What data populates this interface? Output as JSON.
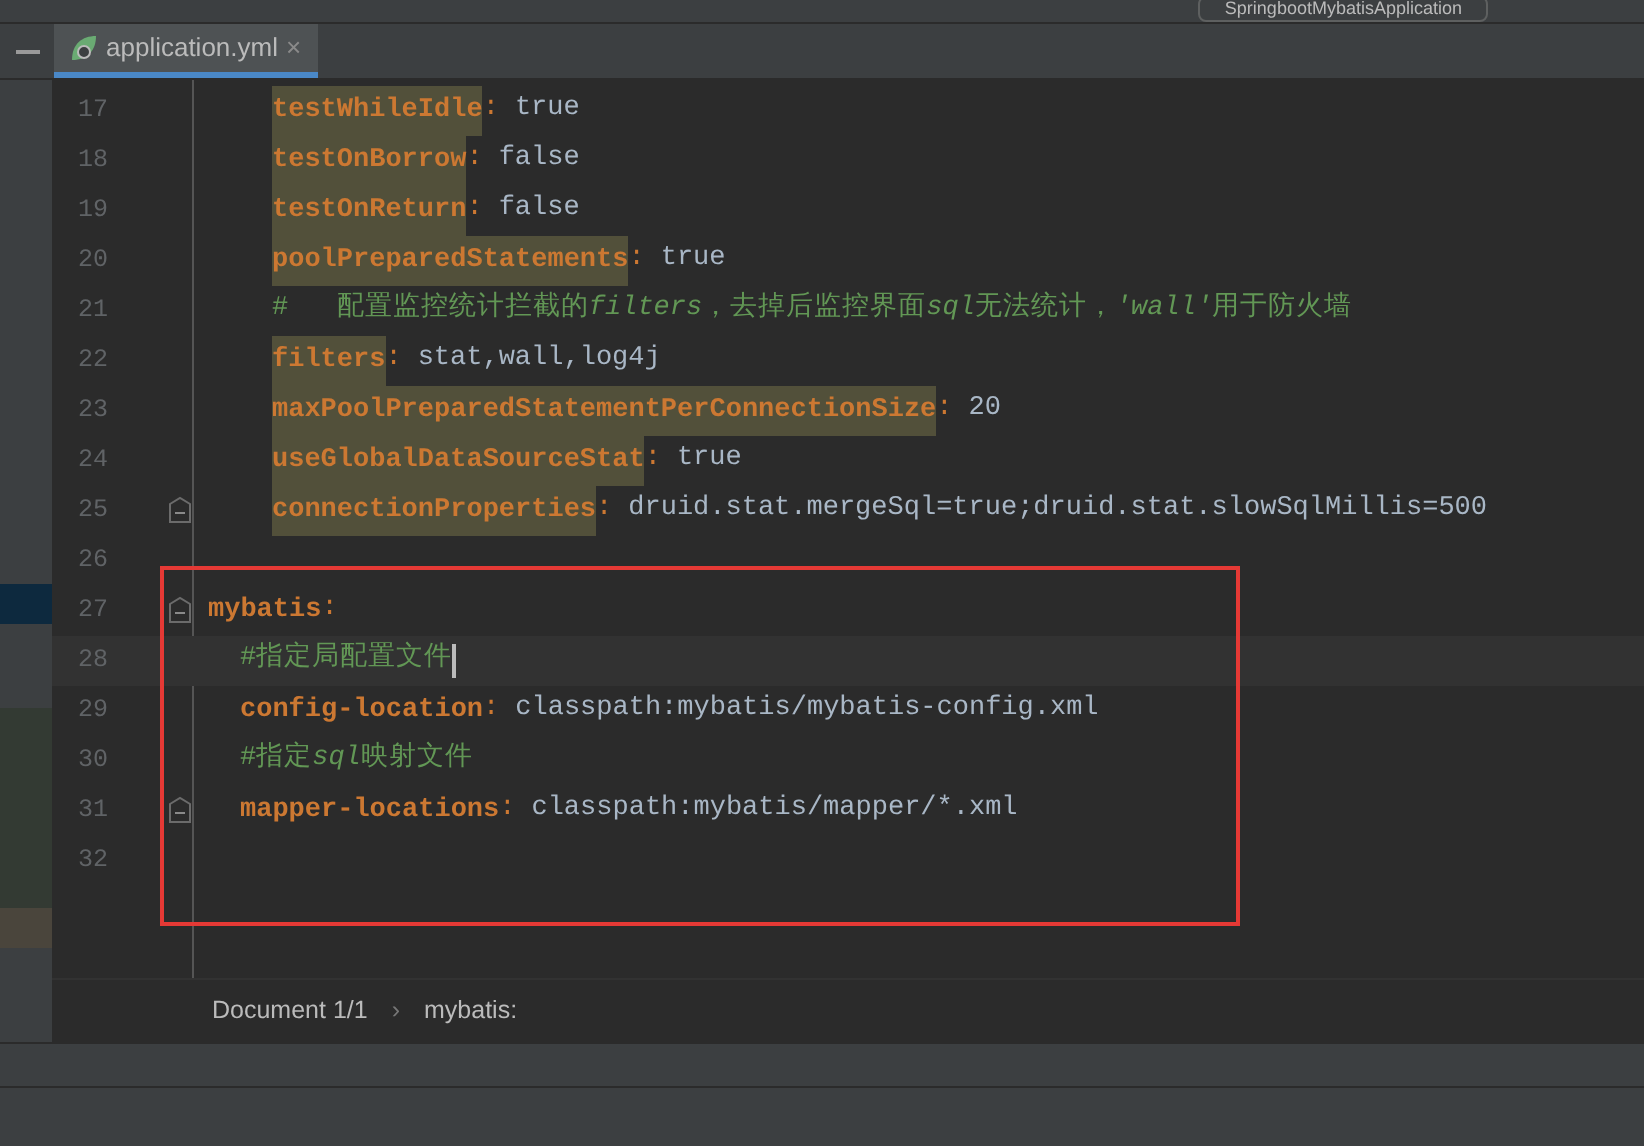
{
  "toolbar": {
    "run_config": "SpringbootMybatisApplication"
  },
  "tabs": [
    {
      "label": "application.yml",
      "close": "×",
      "selected": true
    }
  ],
  "editor": {
    "lines": [
      {
        "kind": "offscreen_parent",
        "children": [
          {
            "kind": "offscreen_parent",
            "children": [
              {
                "kind": "pair",
                "number": "17",
                "key": "testWhileIdle",
                "separator": ":",
                "highlighted": true,
                "value": "true"
              },
              {
                "kind": "pair",
                "number": "18",
                "key": "testOnBorrow",
                "separator": ":",
                "highlighted": true,
                "value": "false"
              },
              {
                "kind": "pair",
                "number": "19",
                "key": "testOnReturn",
                "separator": ":",
                "highlighted": true,
                "value": "false"
              },
              {
                "kind": "pair",
                "number": "20",
                "key": "poolPreparedStatements",
                "separator": ":",
                "highlighted": true,
                "value": "true"
              },
              {
                "kind": "comment",
                "number": "21",
                "comment": [
                  {
                    "text": "#   配置监控统计拦截的",
                    "italic": false
                  },
                  {
                    "text": "filters",
                    "italic": true
                  },
                  {
                    "text": "，去掉后监控界面",
                    "italic": false
                  },
                  {
                    "text": "sql",
                    "italic": true
                  },
                  {
                    "text": "无法统计，",
                    "italic": false
                  },
                  {
                    "text": "'wall'",
                    "italic": true
                  },
                  {
                    "text": "用于防火墙",
                    "italic": false
                  }
                ]
              },
              {
                "kind": "pair",
                "number": "22",
                "key": "filters",
                "separator": ":",
                "highlighted": true,
                "value": "stat,wall,log4j"
              },
              {
                "kind": "pair",
                "number": "23",
                "key": "maxPoolPreparedStatementPerConnectionSize",
                "separator": ":",
                "highlighted": true,
                "value": "20"
              },
              {
                "kind": "pair",
                "number": "24",
                "key": "useGlobalDataSourceStat",
                "separator": ":",
                "highlighted": true,
                "value": "true"
              },
              {
                "kind": "pair",
                "number": "25",
                "key": "connectionProperties",
                "separator": ":",
                "highlighted": true,
                "value": "druid.stat.mergeSql=true;druid.stat.slowSqlMillis=500",
                "fold": true
              }
            ]
          }
        ]
      },
      {
        "kind": "blank",
        "number": "26"
      },
      {
        "kind": "pair",
        "number": "27",
        "key": "mybatis",
        "separator": ":",
        "highlighted": false,
        "fold": true,
        "children": [
          {
            "kind": "comment",
            "number": "28",
            "comment": [
              {
                "text": "#指定局配置文件",
                "italic": false
              }
            ],
            "current": true
          },
          {
            "kind": "pair",
            "number": "29",
            "key": "config-location",
            "separator": ":",
            "highlighted": false,
            "value": "classpath:mybatis/mybatis-config.xml"
          },
          {
            "kind": "comment",
            "number": "30",
            "comment": [
              {
                "text": "#指定",
                "italic": false
              },
              {
                "text": "sql",
                "italic": true
              },
              {
                "text": "映射文件",
                "italic": false
              }
            ]
          },
          {
            "kind": "pair",
            "number": "31",
            "key": "mapper-locations",
            "separator": ":",
            "highlighted": false,
            "value": "classpath:mybatis/mapper/*.xml",
            "fold": true
          }
        ]
      },
      {
        "kind": "blank",
        "number": "32"
      }
    ]
  },
  "breadcrumb": {
    "items": [
      "Document 1/1",
      "mybatis:"
    ],
    "separator": "›"
  }
}
